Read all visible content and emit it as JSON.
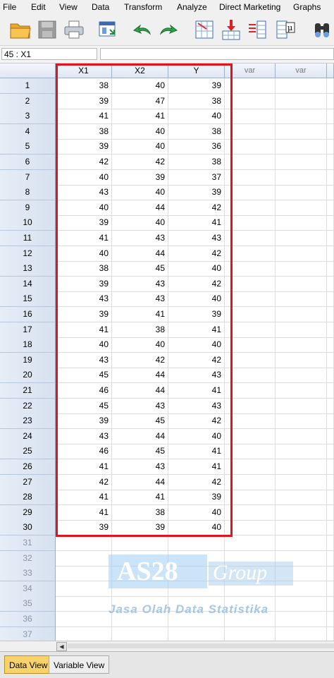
{
  "menu": [
    "File",
    "Edit",
    "View",
    "Data",
    "Transform",
    "Analyze",
    "Direct Marketing",
    "Graphs"
  ],
  "toolbar_icons": [
    "open-folder-icon",
    "save-icon",
    "print-icon",
    "recall-dialog-icon",
    "undo-icon",
    "redo-icon",
    "goto-case-icon",
    "insert-variable-icon",
    "variables-icon",
    "value-labels-icon",
    "find-icon"
  ],
  "cell_reference": "45 : X1",
  "columns": [
    {
      "label": "X1",
      "type": "var"
    },
    {
      "label": "X2",
      "type": "var"
    },
    {
      "label": "Y",
      "type": "var"
    },
    {
      "label": "var",
      "type": "empty"
    },
    {
      "label": "var",
      "type": "empty"
    },
    {
      "label": "",
      "type": "empty"
    }
  ],
  "rows": [
    {
      "n": "1",
      "X1": "38",
      "X2": "40",
      "Y": "39"
    },
    {
      "n": "2",
      "X1": "39",
      "X2": "47",
      "Y": "38"
    },
    {
      "n": "3",
      "X1": "41",
      "X2": "41",
      "Y": "40"
    },
    {
      "n": "4",
      "X1": "38",
      "X2": "40",
      "Y": "38"
    },
    {
      "n": "5",
      "X1": "39",
      "X2": "40",
      "Y": "36"
    },
    {
      "n": "6",
      "X1": "42",
      "X2": "42",
      "Y": "38"
    },
    {
      "n": "7",
      "X1": "40",
      "X2": "39",
      "Y": "37"
    },
    {
      "n": "8",
      "X1": "43",
      "X2": "40",
      "Y": "39"
    },
    {
      "n": "9",
      "X1": "40",
      "X2": "44",
      "Y": "42"
    },
    {
      "n": "10",
      "X1": "39",
      "X2": "40",
      "Y": "41"
    },
    {
      "n": "11",
      "X1": "41",
      "X2": "43",
      "Y": "43"
    },
    {
      "n": "12",
      "X1": "40",
      "X2": "44",
      "Y": "42"
    },
    {
      "n": "13",
      "X1": "38",
      "X2": "45",
      "Y": "40"
    },
    {
      "n": "14",
      "X1": "39",
      "X2": "43",
      "Y": "42"
    },
    {
      "n": "15",
      "X1": "43",
      "X2": "43",
      "Y": "40"
    },
    {
      "n": "16",
      "X1": "39",
      "X2": "41",
      "Y": "39"
    },
    {
      "n": "17",
      "X1": "41",
      "X2": "38",
      "Y": "41"
    },
    {
      "n": "18",
      "X1": "40",
      "X2": "40",
      "Y": "40"
    },
    {
      "n": "19",
      "X1": "43",
      "X2": "42",
      "Y": "42"
    },
    {
      "n": "20",
      "X1": "45",
      "X2": "44",
      "Y": "43"
    },
    {
      "n": "21",
      "X1": "46",
      "X2": "44",
      "Y": "41"
    },
    {
      "n": "22",
      "X1": "45",
      "X2": "43",
      "Y": "43"
    },
    {
      "n": "23",
      "X1": "39",
      "X2": "45",
      "Y": "42"
    },
    {
      "n": "24",
      "X1": "43",
      "X2": "44",
      "Y": "40"
    },
    {
      "n": "25",
      "X1": "46",
      "X2": "45",
      "Y": "41"
    },
    {
      "n": "26",
      "X1": "41",
      "X2": "43",
      "Y": "41"
    },
    {
      "n": "27",
      "X1": "42",
      "X2": "44",
      "Y": "42"
    },
    {
      "n": "28",
      "X1": "41",
      "X2": "41",
      "Y": "39"
    },
    {
      "n": "29",
      "X1": "41",
      "X2": "38",
      "Y": "40"
    },
    {
      "n": "30",
      "X1": "39",
      "X2": "39",
      "Y": "40"
    }
  ],
  "empty_rows": [
    "31",
    "32",
    "33",
    "34",
    "35",
    "36",
    "37"
  ],
  "watermark": {
    "brand": "AS28",
    "group": "Group",
    "tagline": "Jasa Olah Data Statistika"
  },
  "tabs": [
    {
      "label": "Data View",
      "active": true
    },
    {
      "label": "Variable View",
      "active": false
    }
  ],
  "colors": {
    "highlight_border": "#e0141e",
    "active_tab": "#f9d36a",
    "header_bg": "#dfe7f3"
  }
}
